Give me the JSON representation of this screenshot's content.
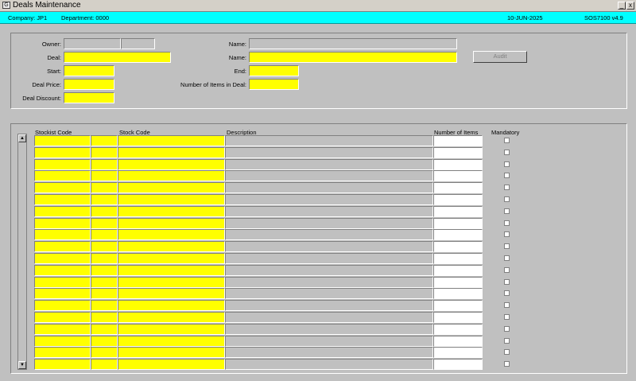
{
  "window": {
    "title": "Deals Maintenance",
    "minimize_glyph": "_",
    "close_glyph": "x",
    "app_icon_glyph": "G"
  },
  "info": {
    "company": "Company:  JP1",
    "department": "Department:  0000",
    "date": "10-JUN-2025",
    "module": "SOS7100  v4.9"
  },
  "header": {
    "owner_label": "Owner:",
    "deal_label": "Deal:",
    "start_label": "Start:",
    "deal_price_label": "Deal Price:",
    "deal_discount_label": "Deal Discount:",
    "owner_name_label": "Name:",
    "deal_name_label": "Name:",
    "end_label": "End:",
    "num_items_label": "Number of Items in Deal:",
    "audit_button": "Audit"
  },
  "grid": {
    "columns": [
      "Stockist Code",
      "Stock Code",
      "Description",
      "Number of Items",
      "Mandatory"
    ],
    "scroll_up_glyph": "▲",
    "scroll_down_glyph": "▼"
  },
  "colors": {
    "required_field": "#ffff00",
    "info_bar": "#00ffff",
    "background": "#c0c0c0"
  }
}
